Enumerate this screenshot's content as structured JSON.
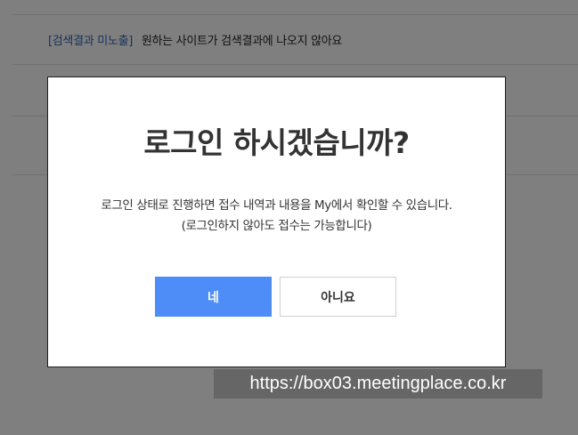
{
  "background": {
    "faq_item": {
      "category": "[검색결과 미노출]",
      "question": "원하는 사이트가 검색결과에 나오지 않아요"
    }
  },
  "dialog": {
    "title": "로그인 하시겠습니까?",
    "message_line1": "로그인 상태로 진행하면 접수 내역과 내용을 My에서 확인할 수 있습니다.",
    "message_line2": "(로그인하지 않아도 접수는 가능합니다)",
    "confirm_label": "네",
    "cancel_label": "아니요"
  },
  "url_caption": "https://box03.meetingplace.co.kr",
  "colors": {
    "accent": "#4e8cf7",
    "category_link": "#2f66b3",
    "overlay": "rgba(0,0,0,0.5)"
  }
}
